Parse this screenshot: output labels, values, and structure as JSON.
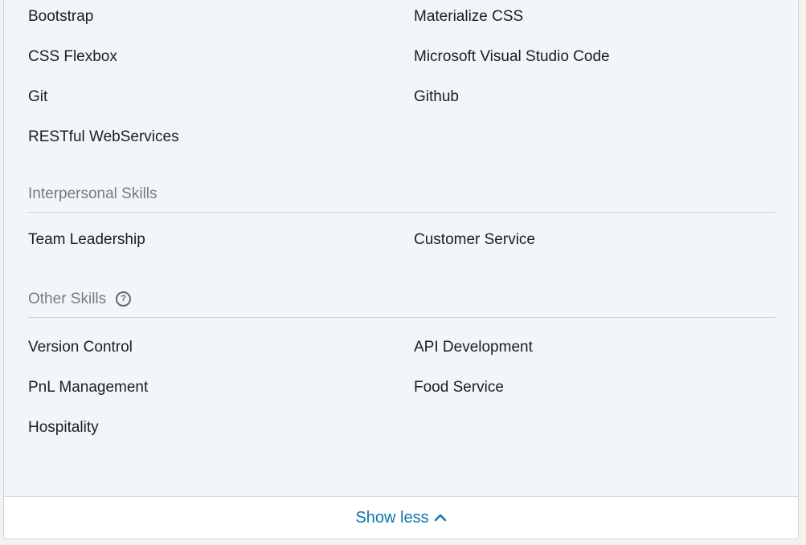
{
  "tools_section": {
    "left": [
      "Bootstrap",
      "CSS Flexbox",
      "Git",
      "RESTful WebServices"
    ],
    "right": [
      "Materialize CSS",
      "Microsoft Visual Studio Code",
      "Github"
    ]
  },
  "interpersonal": {
    "title": "Interpersonal Skills",
    "left": [
      "Team Leadership"
    ],
    "right": [
      "Customer Service"
    ]
  },
  "other": {
    "title": "Other Skills",
    "help_icon": "question-circle-icon",
    "left": [
      "Version Control",
      "PnL Management",
      "Hospitality"
    ],
    "right": [
      "API Development",
      "Food Service"
    ]
  },
  "footer": {
    "show_less_label": "Show less",
    "chevron_icon": "chevron-up-icon"
  }
}
